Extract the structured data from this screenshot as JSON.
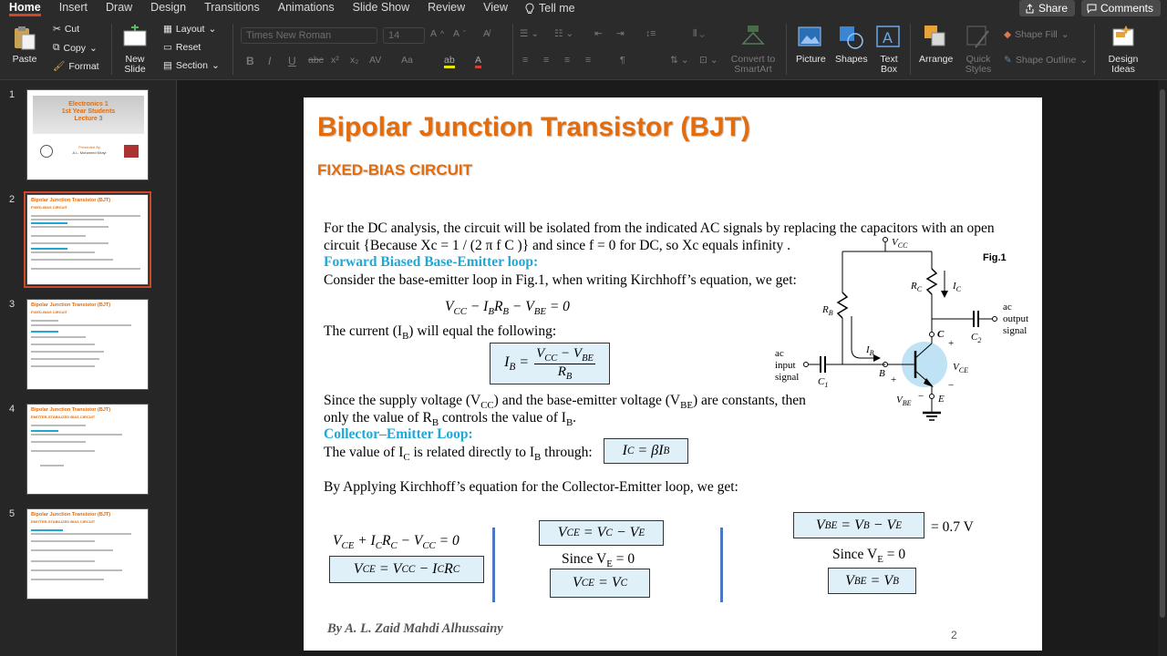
{
  "ribbon_tabs": [
    "Home",
    "Insert",
    "Draw",
    "Design",
    "Transitions",
    "Animations",
    "Slide Show",
    "Review",
    "View"
  ],
  "tell_me": "Tell me",
  "share_label": "Share",
  "comments_label": "Comments",
  "clipboard": {
    "paste": "Paste",
    "cut": "Cut",
    "copy": "Copy",
    "format": "Format"
  },
  "slides_group": {
    "new_slide": "New Slide",
    "layout": "Layout",
    "reset": "Reset",
    "section": "Section"
  },
  "font": {
    "name": "Times New Roman",
    "size": "14"
  },
  "tools": {
    "convert_smartart": "Convert to SmartArt",
    "picture": "Picture",
    "shapes": "Shapes",
    "text_box": "Text Box",
    "arrange": "Arrange",
    "quick_styles": "Quick Styles",
    "shape_fill": "Shape Fill",
    "shape_outline": "Shape Outline",
    "design_ideas": "Design Ideas"
  },
  "thumbnails": [
    {
      "num": "1",
      "title": "Electronics 1\n1st Year Students\nLecture 3",
      "presented": "Presented By",
      "author": "A.L. Mohamed Mrayi"
    },
    {
      "num": "2",
      "title": "Bipolar Junction Transistor (BJT)",
      "sub": "FIXED-BIAS CIRCUIT"
    },
    {
      "num": "3",
      "title": "Bipolar Junction Transistor (BJT)",
      "sub": "FIXED-BIAS CIRCUIT"
    },
    {
      "num": "4",
      "title": "Bipolar Junction Transistor (BJT)",
      "sub": "EMITTER-STABILIZED BIAS CIRCUIT"
    },
    {
      "num": "5",
      "title": "Bipolar Junction Transistor (BJT)",
      "sub": "EMITTER-STABILIZED BIAS CIRCUIT"
    }
  ],
  "slide": {
    "title": "Bipolar Junction Transistor (BJT)",
    "subtitle": "FIXED-BIAS CIRCUIT",
    "intro_1": "For the DC analysis, the circuit will be isolated from the indicated AC signals by replacing the capacitors with an open",
    "intro_2": "circuit {Because Xc = 1 / (2 π f C )} and since f = 0 for DC, so Xc equals infinity .",
    "heading_be": "Forward Biased Base-Emitter loop:",
    "be_text": "Consider the base-emitter loop in Fig.1, when writing Kirchhoff’s equation, we get:",
    "eq_kvl": "V_CC − I_B R_B − V_BE = 0",
    "ib_text": "The current (I_B) will equal the following:",
    "since_1": "Since the supply voltage (V_CC) and the base-emitter voltage (V_BE) are constants, then",
    "since_2": "only the value of R_B controls the value of I_B.",
    "heading_ce": "Collector–Emitter Loop:",
    "ic_text": "The value of I_C is related directly to I_B through:",
    "ic_eq": "I_C = βI_B",
    "kvl_ce_text": "By Applying Kirchhoff’s equation for the Collector-Emitter loop, we get:",
    "eq_ce_sum": "V_CE + I_C R_C − V_CC = 0",
    "eq_ce_result": "V_CE = V_CC − I_C R_C",
    "eq_vce_vc_ve": "V_CE = V_C − V_E",
    "since_ve": "Since V_E = 0",
    "eq_vce_vc": "V_CE = V_C",
    "eq_vbe": "V_BE = V_B − V_E",
    "vbe_value": "= 0.7 V",
    "eq_vbe_vb": "V_BE = V_B",
    "fig_label": "Fig.1",
    "circuit_labels": {
      "vcc": "V_CC",
      "rc": "R_C",
      "ic": "I_C",
      "rb": "R_B",
      "ib": "I_B",
      "c": "C",
      "b": "B",
      "e": "E",
      "vce": "V_CE",
      "vbe": "V_BE",
      "c1": "C_1",
      "c2": "C_2",
      "ac_in": "ac\ninput\nsignal",
      "ac_out": "ac\noutput\nsignal"
    },
    "author": "By A. L. Zaid Mahdi Alhussainy",
    "page_number": "2"
  }
}
